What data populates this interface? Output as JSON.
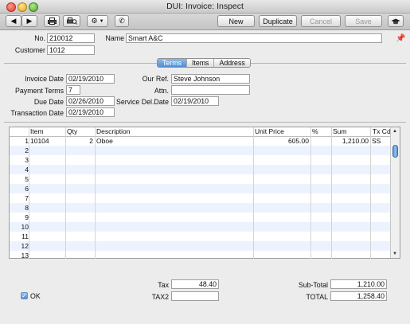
{
  "window": {
    "title": "DUI: Invoice: Inspect"
  },
  "toolbar": {
    "back_icon": "back-arrow-icon",
    "forward_icon": "forward-arrow-icon",
    "print_icon": "printer-icon",
    "print_preview_icon": "print-preview-icon",
    "operations_icon": "gear-icon",
    "phone_icon": "phone-icon",
    "new_label": "New",
    "duplicate_label": "Duplicate",
    "cancel_label": "Cancel",
    "save_label": "Save",
    "graduation_icon": "graduation-cap-icon"
  },
  "header": {
    "no_label": "No.",
    "no_value": "210012",
    "name_label": "Name",
    "name_value": "Smart A&C",
    "customer_label": "Customer",
    "customer_value": "1012",
    "pin_icon": "pin-icon"
  },
  "tabs": [
    {
      "label": "Terms",
      "active": true
    },
    {
      "label": "Items",
      "active": false
    },
    {
      "label": "Address",
      "active": false
    }
  ],
  "terms": {
    "invoice_date_label": "Invoice Date",
    "invoice_date_value": "02/19/2010",
    "payment_terms_label": "Payment Terms",
    "payment_terms_value": "7",
    "due_date_label": "Due Date",
    "due_date_value": "02/26/2010",
    "transaction_date_label": "Transaction Date",
    "transaction_date_value": "02/19/2010",
    "our_ref_label": "Our Ref.",
    "our_ref_value": "Steve Johnson",
    "attn_label": "Attn.",
    "attn_value": "",
    "service_del_date_label": "Service Del.Date",
    "service_del_date_value": "02/19/2010"
  },
  "grid": {
    "columns": [
      "Item",
      "Qty",
      "Description",
      "Unit Price",
      "%",
      "Sum",
      "Tx Cd"
    ],
    "rows": [
      {
        "num": "1",
        "item": "10104",
        "qty": "2",
        "description": "Oboe",
        "unit_price": "605.00",
        "percent": "",
        "sum": "1,210.00",
        "tx_cd": "SS"
      },
      {
        "num": "2",
        "item": "",
        "qty": "",
        "description": "",
        "unit_price": "",
        "percent": "",
        "sum": "",
        "tx_cd": ""
      },
      {
        "num": "3",
        "item": "",
        "qty": "",
        "description": "",
        "unit_price": "",
        "percent": "",
        "sum": "",
        "tx_cd": ""
      },
      {
        "num": "4",
        "item": "",
        "qty": "",
        "description": "",
        "unit_price": "",
        "percent": "",
        "sum": "",
        "tx_cd": ""
      },
      {
        "num": "5",
        "item": "",
        "qty": "",
        "description": "",
        "unit_price": "",
        "percent": "",
        "sum": "",
        "tx_cd": ""
      },
      {
        "num": "6",
        "item": "",
        "qty": "",
        "description": "",
        "unit_price": "",
        "percent": "",
        "sum": "",
        "tx_cd": ""
      },
      {
        "num": "7",
        "item": "",
        "qty": "",
        "description": "",
        "unit_price": "",
        "percent": "",
        "sum": "",
        "tx_cd": ""
      },
      {
        "num": "8",
        "item": "",
        "qty": "",
        "description": "",
        "unit_price": "",
        "percent": "",
        "sum": "",
        "tx_cd": ""
      },
      {
        "num": "9",
        "item": "",
        "qty": "",
        "description": "",
        "unit_price": "",
        "percent": "",
        "sum": "",
        "tx_cd": ""
      },
      {
        "num": "10",
        "item": "",
        "qty": "",
        "description": "",
        "unit_price": "",
        "percent": "",
        "sum": "",
        "tx_cd": ""
      },
      {
        "num": "11",
        "item": "",
        "qty": "",
        "description": "",
        "unit_price": "",
        "percent": "",
        "sum": "",
        "tx_cd": ""
      },
      {
        "num": "12",
        "item": "",
        "qty": "",
        "description": "",
        "unit_price": "",
        "percent": "",
        "sum": "",
        "tx_cd": ""
      },
      {
        "num": "13",
        "item": "",
        "qty": "",
        "description": "",
        "unit_price": "",
        "percent": "",
        "sum": "",
        "tx_cd": ""
      }
    ]
  },
  "footer": {
    "ok_label": "OK",
    "ok_checked": true,
    "tax_label": "Tax",
    "tax_value": "48.40",
    "tax2_label": "TAX2",
    "tax2_value": "",
    "subtotal_label": "Sub-Total",
    "subtotal_value": "1,210.00",
    "total_label": "TOTAL",
    "total_value": "1,258.40"
  },
  "colors": {
    "accent": "#4e8fd3",
    "alt_row": "#edf3fe"
  }
}
